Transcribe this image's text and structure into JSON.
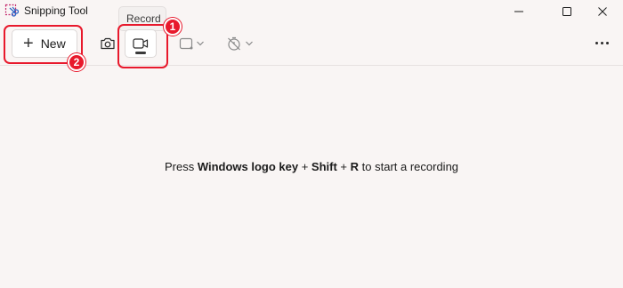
{
  "window": {
    "title": "Snipping Tool"
  },
  "tooltip": {
    "text": "Record"
  },
  "toolbar": {
    "new_label": "New",
    "new_icon": "plus-icon",
    "snip_mode_icon": "camera-icon",
    "record_mode_icon": "video-camera-icon",
    "shape_icon": "rectangle-selection-icon",
    "delay_icon": "timer-off-icon",
    "more_icon": "more-horizontal-icon"
  },
  "message": {
    "prefix": "Press ",
    "key1": "Windows logo key",
    "plus1": " + ",
    "key2": "Shift",
    "plus2": " + ",
    "key3": "R",
    "suffix": " to start a recording"
  },
  "annotations": {
    "badge1": "1",
    "badge2": "2",
    "color": "#e8192c"
  },
  "colors": {
    "background": "#f9f5f4",
    "button_bg": "#ffffff"
  }
}
